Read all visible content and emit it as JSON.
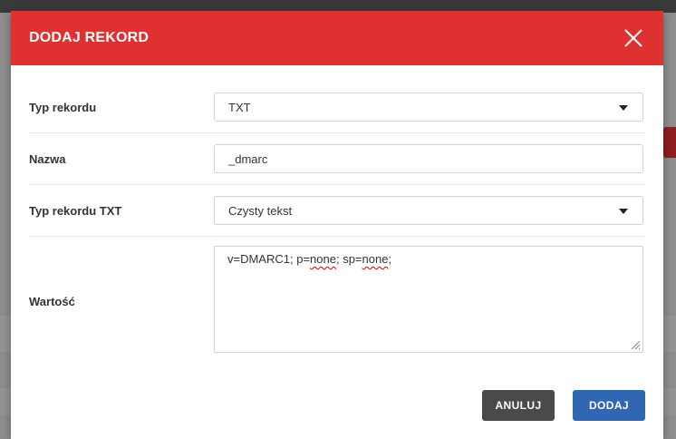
{
  "dialog": {
    "title": "DODAJ REKORD",
    "accent_color": "#e03131",
    "close_icon": "close-icon"
  },
  "form": {
    "record_type": {
      "label": "Typ rekordu",
      "value": "TXT"
    },
    "name": {
      "label": "Nazwa",
      "value": "_dmarc"
    },
    "txt_record_type": {
      "label": "Typ rekordu TXT",
      "value": "Czysty tekst"
    },
    "value": {
      "label": "Wartość",
      "parts": [
        "v=DMARC1; p=",
        "none",
        "; sp=",
        "none",
        ";"
      ]
    }
  },
  "actions": {
    "cancel_label": "ANULUJ",
    "cancel_color": "#4a4a4a",
    "submit_label": "DODAJ",
    "submit_color": "#2f67b5"
  }
}
